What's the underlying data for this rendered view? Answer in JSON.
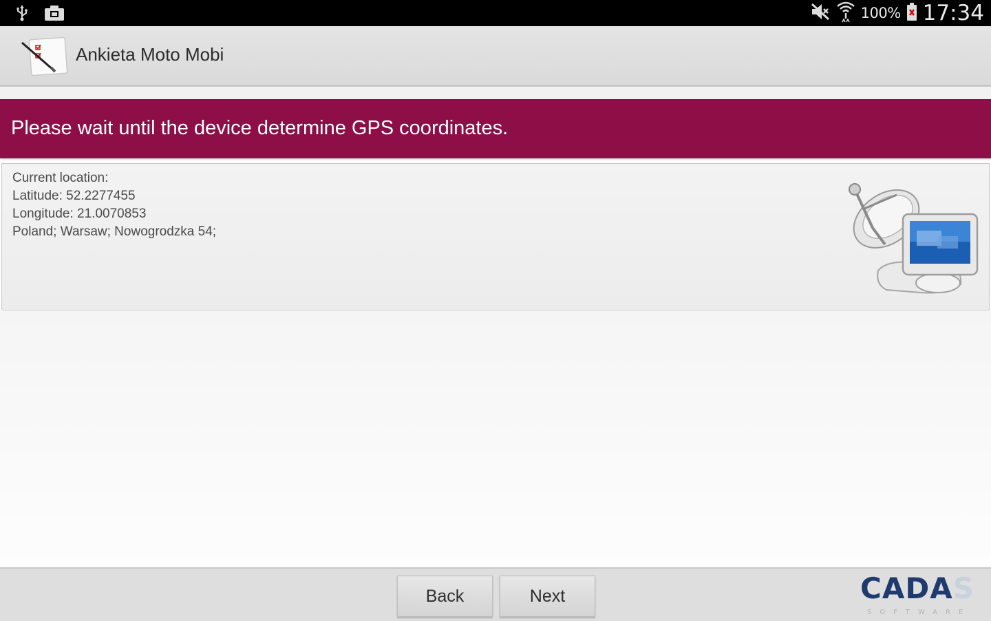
{
  "status_bar": {
    "battery_percent": "100%",
    "time": "17:34",
    "icons": [
      "usb-icon",
      "screenshot-icon",
      "mute-icon",
      "wifi-icon",
      "battery-icon"
    ]
  },
  "app": {
    "title": "Ankieta Moto Mobi",
    "icon": "app-survey-icon"
  },
  "banner": {
    "message": "Please wait until the device determine GPS coordinates.",
    "color": "#8e0f48"
  },
  "location": {
    "label": "Current location:",
    "latitude": "Latitude: 52.2277455",
    "longitude": "Longitude: 21.0070853",
    "address": "Poland; Warsaw; Nowogrodzka 54;",
    "illustration": "satellite-computer-icon"
  },
  "buttons": {
    "back": "Back",
    "next": "Next"
  },
  "logo": {
    "main": "CADA",
    "tail": "S",
    "sub": "SOFTWARE"
  }
}
